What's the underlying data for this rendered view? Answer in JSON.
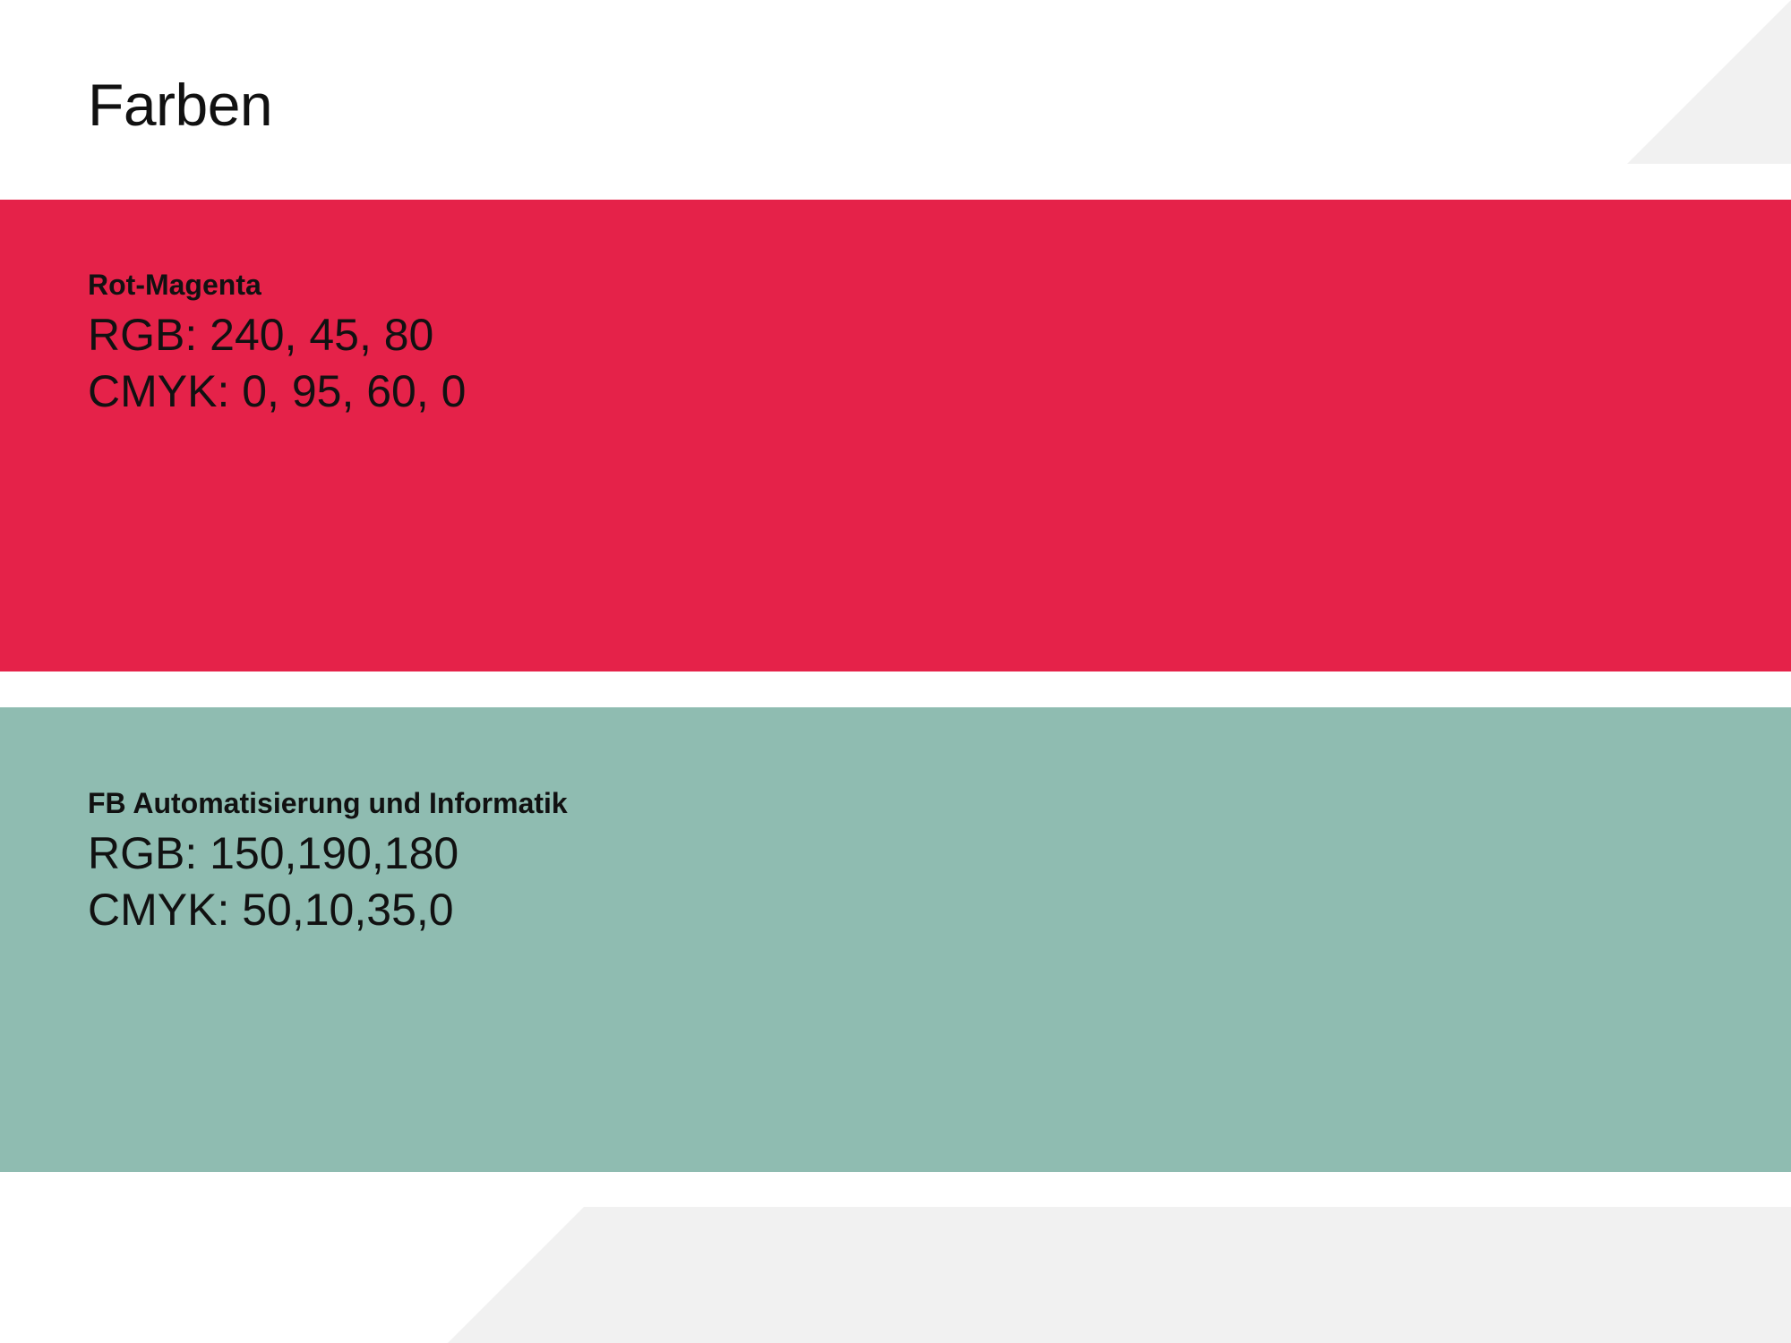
{
  "page": {
    "title": "Farben"
  },
  "colors": {
    "accent": "#e52249",
    "secondary": "#8fbcb1",
    "decoration": "#f1f1f1"
  },
  "swatches": [
    {
      "name": "Rot-Magenta",
      "rgb": "RGB: 240, 45, 80",
      "cmyk": "CMYK: 0, 95, 60, 0"
    },
    {
      "name": "FB Automatisierung und Informatik",
      "rgb": "RGB: 150,190,180",
      "cmyk": "CMYK: 50,10,35,0"
    }
  ]
}
